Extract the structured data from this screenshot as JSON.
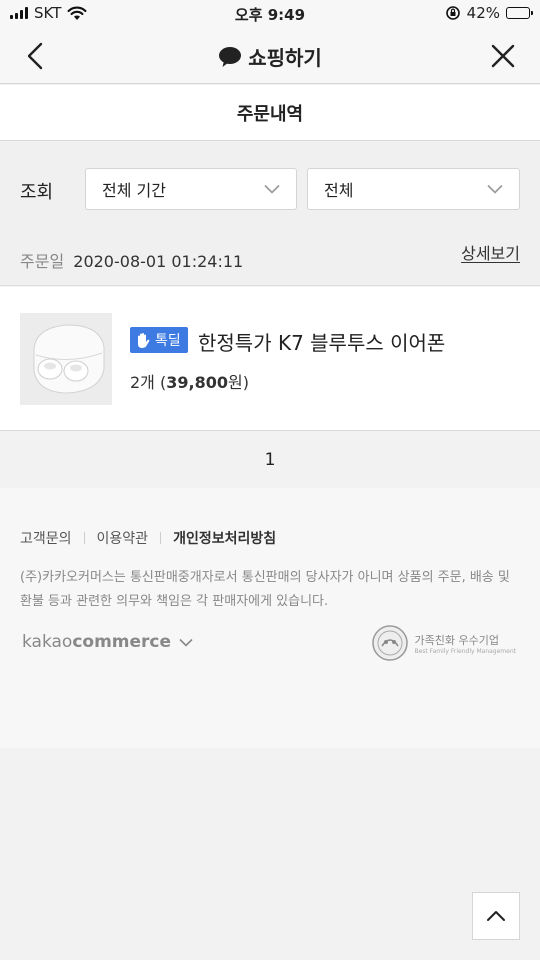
{
  "status_bar": {
    "carrier": "SKT",
    "time": "오후 9:49",
    "battery_percent": "42%",
    "battery_level": 0.42
  },
  "nav": {
    "title": "쇼핑하기",
    "back_icon": "chevron-left-icon",
    "close_icon": "close-icon",
    "title_icon": "speech-bubble-icon"
  },
  "page": {
    "title": "주문내역"
  },
  "filter": {
    "label": "조회",
    "period_value": "전체 기간",
    "status_value": "전체"
  },
  "order": {
    "date_label": "주문일",
    "date_value": "2020-08-01 01:24:11",
    "detail_link": "상세보기"
  },
  "product": {
    "badge": "톡딜",
    "name": "한정특가 K7 블루투스 이어폰",
    "qty_prefix": "2개 (",
    "price": "39,800",
    "price_suffix": "원)"
  },
  "pagination": {
    "current": "1"
  },
  "footer": {
    "links": [
      "고객문의",
      "이용약관",
      "개인정보처리방침"
    ],
    "notice": "(주)카카오커머스는 통신판매중개자로서 통신판매의 당사자가 아니며 상품의 주문, 배송 및 환불 등과 관련한 의무와 책임은 각 판매자에게 있습니다.",
    "brand_prefix": "kakao",
    "brand_suffix": "commerce",
    "family_title": "가족친화 우수기업",
    "family_sub": "Best Family Friendly Management"
  },
  "colors": {
    "badge_blue": "#3d7be2",
    "battery_green": "#4cd964"
  }
}
